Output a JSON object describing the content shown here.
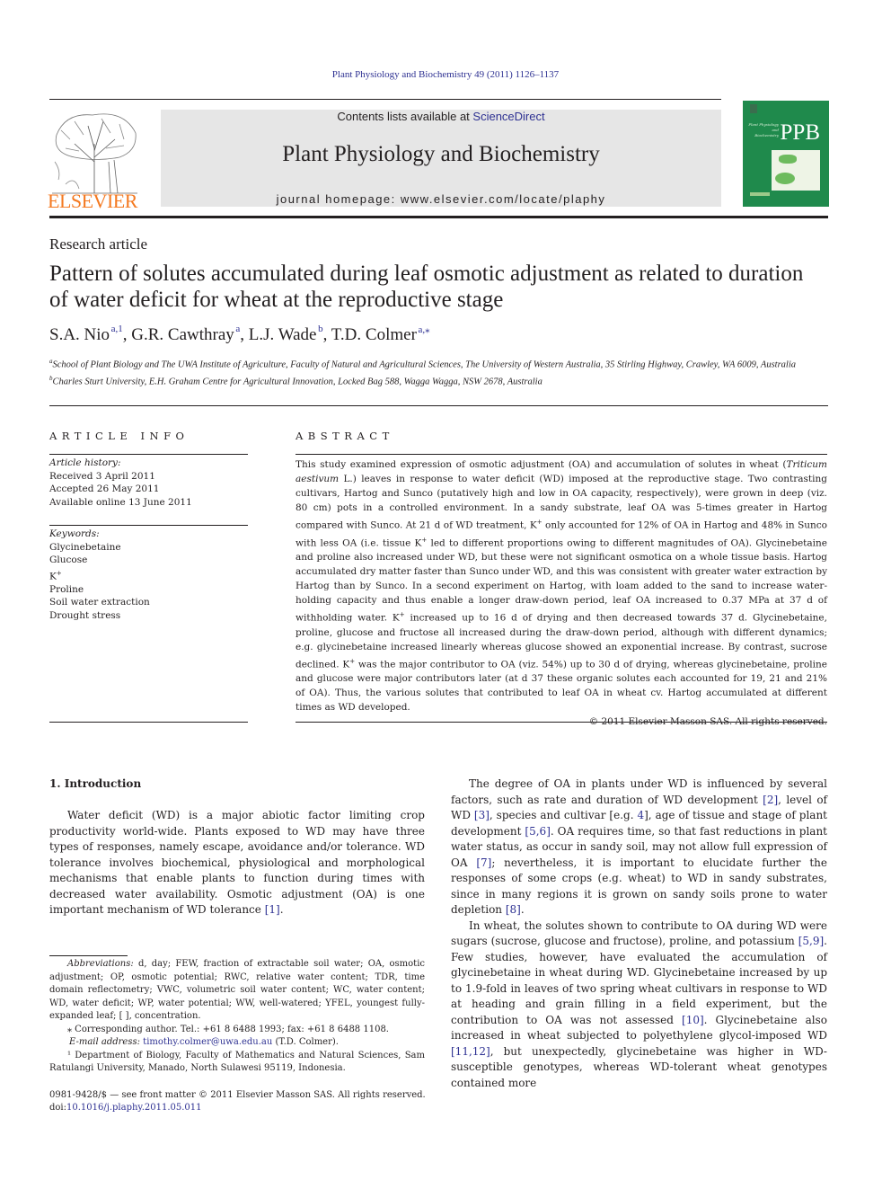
{
  "header": {
    "citation": "Plant Physiology and Biochemistry 49 (2011) 1126–1137",
    "publisher_logo_text": "ELSEVIER",
    "contents_prefix": "Contents lists available at ",
    "contents_link": "ScienceDirect",
    "journal_name": "Plant Physiology and Biochemistry",
    "homepage": "journal homepage: www.elsevier.com/locate/plaphy",
    "cover_abbrev": "PPB",
    "cover_small_title": "Plant Physiology and Biochemistry",
    "colors": {
      "link": "#2e3192",
      "elsevier_orange": "#f47920",
      "cover_green": "#1f8a4c",
      "banner_gray": "#e6e6e6"
    }
  },
  "article": {
    "type": "Research article",
    "title": "Pattern of solutes accumulated during leaf osmotic adjustment as related to duration of water deficit for wheat at the reproductive stage",
    "authors": [
      {
        "name": "S.A. Nio",
        "sup": "a,1"
      },
      {
        "name": "G.R. Cawthray",
        "sup": "a"
      },
      {
        "name": "L.J. Wade",
        "sup": "b"
      },
      {
        "name": "T.D. Colmer",
        "sup": "a,⁎"
      }
    ],
    "affiliations": [
      {
        "mark": "a",
        "text": "School of Plant Biology and The UWA Institute of Agriculture, Faculty of Natural and Agricultural Sciences, The University of Western Australia, 35 Stirling Highway, Crawley, WA 6009, Australia"
      },
      {
        "mark": "b",
        "text": "Charles Sturt University, E.H. Graham Centre for Agricultural Innovation, Locked Bag 588, Wagga Wagga, NSW 2678, Australia"
      }
    ]
  },
  "article_info": {
    "heading": "ARTICLE INFO",
    "history_label": "Article history:",
    "history": [
      "Received 3 April 2011",
      "Accepted 26 May 2011",
      "Available online 13 June 2011"
    ],
    "keywords_label": "Keywords:",
    "keywords": [
      "Glycinebetaine",
      "Glucose",
      "K+",
      "Proline",
      "Soil water extraction",
      "Drought stress"
    ]
  },
  "abstract": {
    "heading": "ABSTRACT",
    "p1_a": "This study examined expression of osmotic adjustment (OA) and accumulation of solutes in wheat (",
    "p1_italic": "Triticum aestivum",
    "p1_b": " L.) leaves in response to water deficit (WD) imposed at the reproductive stage. Two contrasting cultivars, Hartog and Sunco (putatively high and low in OA capacity, respectively), were grown in deep (viz. 80 cm) pots in a controlled environment. In a sandy substrate, leaf OA was 5-times greater in Hartog compared with Sunco. At 21 d of WD treatment, K",
    "p1_c": " only accounted for 12% of OA in Hartog and 48% in Sunco with less OA (i.e. tissue K",
    "p1_d": " led to different proportions owing to different magnitudes of OA). Glycinebetaine and proline also increased under WD, but these were not significant osmotica on a whole tissue basis. Hartog accumulated dry matter faster than Sunco under WD, and this was consistent with greater water extraction by Hartog than by Sunco. In a second experiment on Hartog, with loam added to the sand to increase water-holding capacity and thus enable a longer draw-down period, leaf OA increased to 0.37 MPa at 37 d of withholding water. K",
    "p1_e": " increased up to 16 d of drying and then decreased towards 37 d. Glycinebetaine, proline, glucose and fructose all increased during the draw-down period, although with different dynamics; e.g. glycinebetaine increased linearly whereas glucose showed an exponential increase. By contrast, sucrose declined. K",
    "p1_f": " was the major contributor to OA (viz. 54%) up to 30 d of drying, whereas glycinebetaine, proline and glucose were major contributors later (at d 37 these organic solutes each accounted for 19, 21 and 21% of OA). Thus, the various solutes that contributed to leaf OA in wheat cv. Hartog accumulated at different times as WD developed.",
    "plus": "+",
    "copyright": "© 2011 Elsevier Masson SAS. All rights reserved."
  },
  "introduction": {
    "heading": "1.  Introduction",
    "left_p1_a": "Water deficit (WD) is a major abiotic factor limiting crop productivity world-wide. Plants exposed to WD may have three types of responses, namely escape, avoidance and/or tolerance. WD tolerance involves biochemical, physiological and morphological mechanisms that enable plants to function during times with decreased water availability. Osmotic adjustment (OA) is one important mechanism of WD tolerance ",
    "left_p1_ref": "[1]",
    "right_p1": [
      {
        "t": "The degree of OA in plants under WD is influenced by several factors, such as rate and duration of WD development "
      },
      {
        "r": "[2]"
      },
      {
        "t": ", level of WD "
      },
      {
        "r": "[3]"
      },
      {
        "t": ", species and cultivar [e.g. "
      },
      {
        "r": "4"
      },
      {
        "t": "], age of tissue and stage of plant development "
      },
      {
        "r": "[5,6]"
      },
      {
        "t": ". OA requires time, so that fast reductions in plant water status, as occur in sandy soil, may not allow full expression of OA "
      },
      {
        "r": "[7]"
      },
      {
        "t": "; nevertheless, it is important to elucidate further the responses of some crops (e.g. wheat) to WD in sandy substrates, since in many regions it is grown on sandy soils prone to water depletion "
      },
      {
        "r": "[8]"
      },
      {
        "t": "."
      }
    ],
    "right_p2": [
      {
        "t": "In wheat, the solutes shown to contribute to OA during WD were sugars (sucrose, glucose and fructose), proline, and potassium "
      },
      {
        "r": "[5,9]"
      },
      {
        "t": ". Few studies, however, have evaluated the accumulation of glycinebetaine in wheat during WD. Glycinebetaine increased by up to 1.9-fold in leaves of two spring wheat cultivars in response to WD at heading and grain filling in a field experiment, but the contribution to OA was not assessed "
      },
      {
        "r": "[10]"
      },
      {
        "t": ". Glycinebetaine also increased in wheat subjected to polyethylene glycol-imposed WD "
      },
      {
        "r": "[11,12]"
      },
      {
        "t": ", but unexpectedly, glycinebetaine was higher in WD-susceptible genotypes, whereas WD-tolerant wheat genotypes contained more"
      }
    ]
  },
  "footnotes": {
    "abbrev_label": "Abbreviations:",
    "abbrev_text": " d, day; FEW, fraction of extractable soil water; OA, osmotic adjustment; OP, osmotic potential; RWC, relative water content; TDR, time domain reflectometry; VWC, volumetric soil water content; WC, water content; WD, water deficit; WP, water potential; WW, well-watered; YFEL, youngest fully-expanded leaf; [ ], concentration.",
    "corresponding": "⁎ Corresponding author. Tel.: +61 8 6488 1993; fax: +61 8 6488 1108.",
    "email_label": "E-mail address:",
    "email": "timothy.colmer@uwa.edu.au",
    "email_suffix": " (T.D. Colmer).",
    "fn1": "¹ Department of Biology, Faculty of Mathematics and Natural Sciences, Sam Ratulangi University, Manado, North Sulawesi 95119, Indonesia."
  },
  "front_matter": {
    "issn_line": "0981-9428/$ — see front matter © 2011 Elsevier Masson SAS. All rights reserved.",
    "doi_label": "doi:",
    "doi": "10.1016/j.plaphy.2011.05.011"
  }
}
